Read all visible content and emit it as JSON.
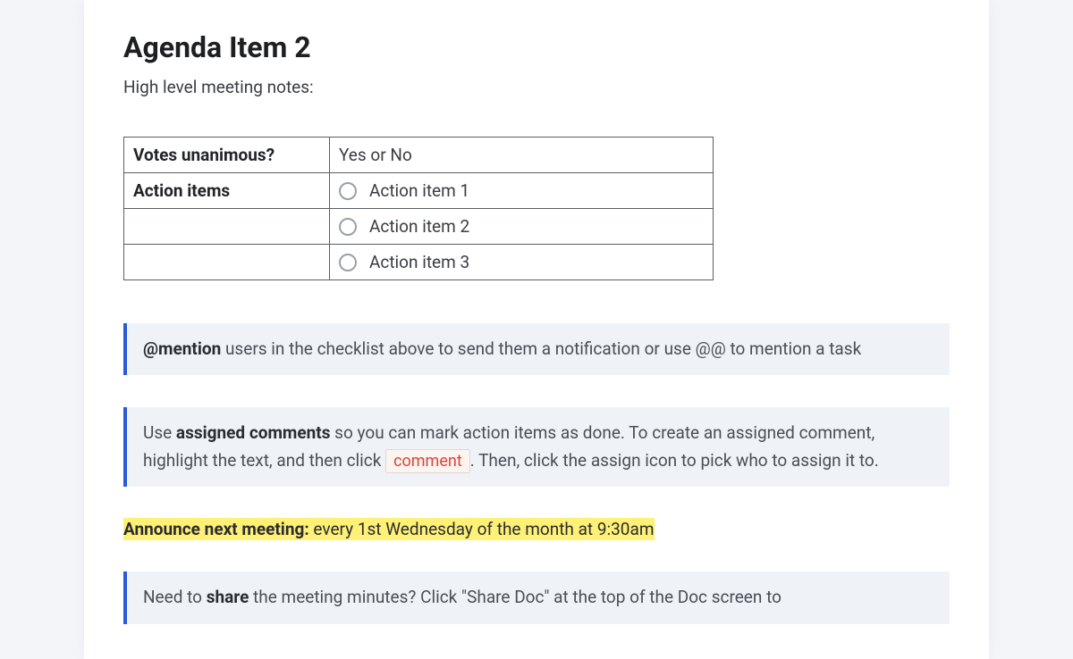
{
  "title": "Agenda Item 2",
  "subtitle": "High level meeting notes:",
  "table": {
    "row1_label": "Votes unanimous?",
    "row1_value": "Yes or No",
    "row2_label": "Action items",
    "items": [
      "Action item 1",
      "Action item 2",
      "Action item 3"
    ]
  },
  "callout1": {
    "bold": "@mention",
    "rest": " users in the checklist above to send them a notification or use @@ to mention a task"
  },
  "callout2": {
    "pre": "Use ",
    "bold": "assigned comments",
    "mid": " so you can mark action items as done. To create an assigned comment, highlight the text, and then click ",
    "badge": "comment",
    "post": ". Then, click the assign icon to pick who to assign it to."
  },
  "highlight": {
    "bold": "Announce next meeting:",
    "rest": " every 1st Wednesday of the month at 9:30am"
  },
  "callout3": {
    "pre": "Need to ",
    "bold": "share",
    "post": " the meeting minutes? Click \"Share Doc\" at the top of the Doc screen to"
  }
}
